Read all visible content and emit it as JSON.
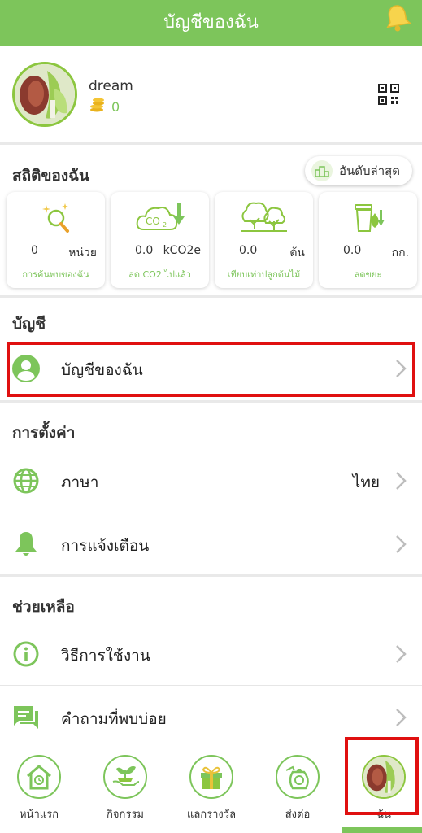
{
  "header": {
    "title": "บัญชีของฉัน",
    "bell_icon": "bell-icon"
  },
  "profile": {
    "name": "dream",
    "coins": "0",
    "qr_icon": "qr-code-icon"
  },
  "stats": {
    "title": "สถิติของฉัน",
    "ranking_label": "อันดับล่าสุด",
    "cards": [
      {
        "icon": "magnifier-sparkle-icon",
        "value": "0",
        "unit": "หน่วย",
        "label": "การค้นพบของฉัน"
      },
      {
        "icon": "co2-cloud-icon",
        "value": "0.0",
        "unit": "kCO2e",
        "label": "ลด CO2 ไปแล้ว"
      },
      {
        "icon": "trees-icon",
        "value": "0.0",
        "unit": "ต้น",
        "label": "เทียบเท่าปลูกต้นไม้"
      },
      {
        "icon": "trash-bin-icon",
        "value": "0.0",
        "unit": "กก.",
        "label": "ลดขยะ"
      }
    ]
  },
  "account": {
    "title": "บัญชี",
    "my_account": "บัญชีของฉัน"
  },
  "settings": {
    "title": "การตั้งค่า",
    "language_label": "ภาษา",
    "language_value": "ไทย",
    "notifications_label": "การแจ้งเตือน"
  },
  "help": {
    "title": "ช่วยเหลือ",
    "howto_label": "วิธีการใช้งาน",
    "faq_label": "คำถามที่พบบ่อย"
  },
  "tabs": [
    {
      "label": "หน้าแรก",
      "icon": "home-icon"
    },
    {
      "label": "กิจกรรม",
      "icon": "plant-hands-icon"
    },
    {
      "label": "แลกรางวัล",
      "icon": "gift-icon"
    },
    {
      "label": "ส่งต่อ",
      "icon": "money-bag-icon"
    },
    {
      "label": "ฉัน",
      "icon": "avatar-icon"
    }
  ],
  "colors": {
    "brand": "#7dc55b",
    "highlight": "#e01010"
  }
}
